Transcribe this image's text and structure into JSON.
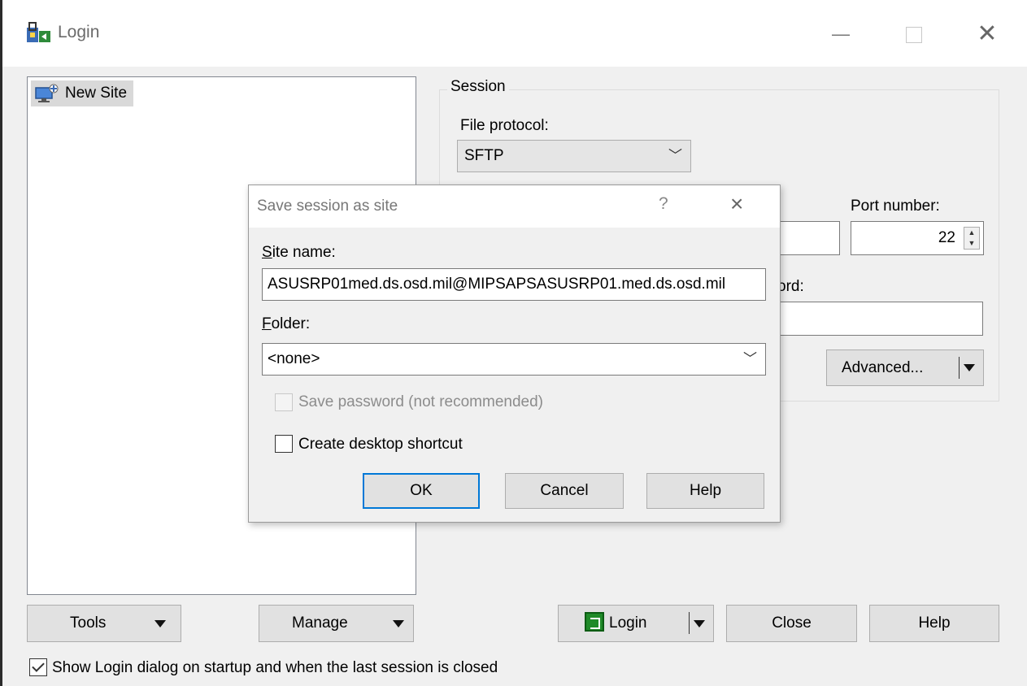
{
  "window": {
    "title": "Login",
    "icons": {
      "app": "winscp-login-icon",
      "minimize": "minimize-icon",
      "maximize": "maximize-icon",
      "close": "close-icon"
    }
  },
  "site_tree": {
    "items": [
      {
        "label": "New Site",
        "icon": "new-site-computer-icon",
        "selected": true
      }
    ]
  },
  "session": {
    "group_label": "Session",
    "file_protocol_label": "File protocol:",
    "file_protocol_value": "SFTP",
    "port_label": "Port number:",
    "port_value": "22",
    "password_label_visible": "ord:",
    "advanced_label": "Advanced..."
  },
  "bottom": {
    "tools_label": "Tools",
    "manage_label": "Manage",
    "login_label": "Login",
    "close_label": "Close",
    "help_label": "Help",
    "show_login_checkbox": {
      "label": "Show Login dialog on startup and when the last session is closed",
      "checked": true
    }
  },
  "dialog": {
    "title": "Save session as site",
    "help_glyph": "?",
    "close_glyph": "×",
    "site_name_label_first": "S",
    "site_name_label_rest": "ite name:",
    "site_name_value": "ASUSRP01med.ds.osd.mil@MIPSAPSASUSRP01.med.ds.osd.mil",
    "folder_label_first": "F",
    "folder_label_rest": "older:",
    "folder_value": "<none>",
    "save_password": {
      "label": "Save password (not recommended)",
      "checked": false,
      "disabled": true
    },
    "desktop_shortcut": {
      "label": "Create desktop shortcut",
      "checked": false
    },
    "ok_label": "OK",
    "cancel_label": "Cancel",
    "help_label": "Help"
  }
}
